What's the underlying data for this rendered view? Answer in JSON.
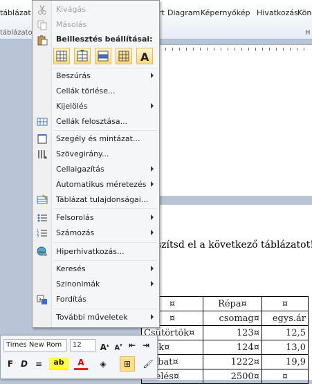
{
  "ribbon": {
    "tablazat": "táblázat",
    "tablazatok": "táblázatok",
    "clip_art": "rt",
    "diagram": "Diagram",
    "kepernyokep": "Képernyőkép",
    "hivatkozas": "Hivatkozás",
    "kon": "Kön",
    "group_h": "H"
  },
  "menu": {
    "cut": "Kivágás",
    "copy": "Másolás",
    "paste_header": "Beillesztés beállításai:",
    "items": [
      {
        "label": "Beszúrás",
        "submenu": true
      },
      {
        "label": "Cellák törlése...",
        "submenu": false
      },
      {
        "label": "Kijelölés",
        "submenu": true
      },
      {
        "label": "Cellák felosztása...",
        "submenu": false
      },
      {
        "label": "Szegély és mintázat...",
        "submenu": false
      },
      {
        "label": "Szövegirány...",
        "submenu": false
      },
      {
        "label": "Cellaigazítás",
        "submenu": true
      },
      {
        "label": "Automatikus méretezés",
        "submenu": true
      },
      {
        "label": "Táblázat tulajdonságai...",
        "submenu": false
      },
      {
        "label": "Felsorolás",
        "submenu": true
      },
      {
        "label": "Számozás",
        "submenu": true
      },
      {
        "label": "Hiperhivatkozás...",
        "submenu": false
      },
      {
        "label": "Keresés",
        "submenu": true
      },
      {
        "label": "Szinonimák",
        "submenu": true
      },
      {
        "label": "Fordítás",
        "submenu": false
      },
      {
        "label": "További műveletek",
        "submenu": true
      }
    ]
  },
  "document": {
    "instruction": "szítsd el a következő táblázatot!¶",
    "pilcrow1": "¶",
    "pilcrow2": "¶",
    "table": [
      [
        "¤",
        "Répa¤",
        "¤"
      ],
      [
        "¤",
        "csomag¤",
        "egys.ár"
      ],
      [
        "Csütörtök¤",
        "123¤",
        "12,5"
      ],
      [
        "ntek¤",
        "124¤",
        "13,0"
      ],
      [
        "ombat¤",
        "1222¤",
        "19,9"
      ],
      [
        "ndelés¤",
        "2500¤",
        "¤"
      ]
    ]
  },
  "minitoolbar": {
    "font": "Times New Rom",
    "size": "12",
    "bold": "F",
    "italic": "D"
  }
}
